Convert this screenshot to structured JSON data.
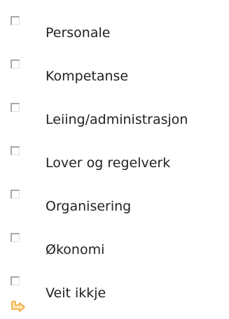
{
  "options": [
    {
      "label": "Personale",
      "checked": false
    },
    {
      "label": "Kompetanse",
      "checked": false
    },
    {
      "label": "Leiing/administrasjon",
      "checked": false
    },
    {
      "label": "Lover og regelverk",
      "checked": false
    },
    {
      "label": "Organisering",
      "checked": false
    },
    {
      "label": "Økonomi",
      "checked": false
    },
    {
      "label": "Veit ikkje",
      "checked": false
    }
  ],
  "next": {
    "icon": "arrow-right-icon",
    "color": "#f0a030"
  }
}
